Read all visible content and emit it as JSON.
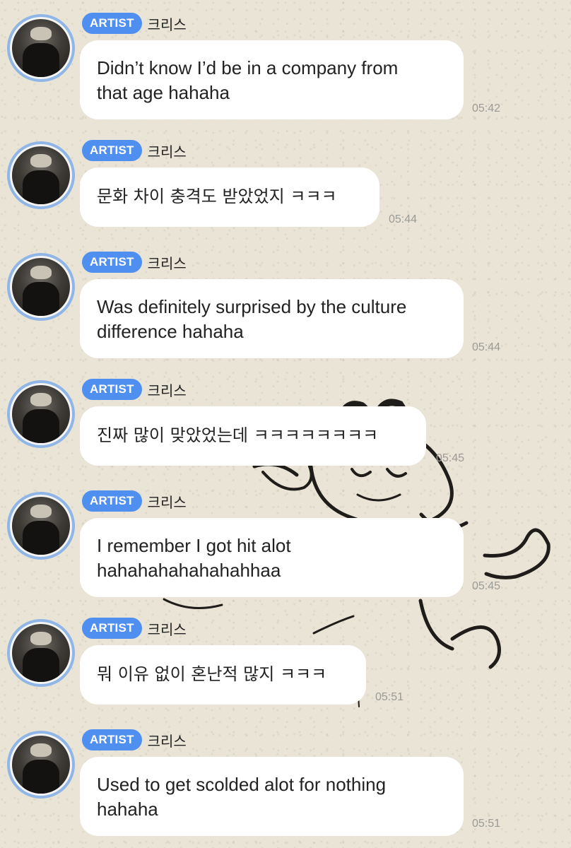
{
  "badge_label": "ARTIST",
  "sender_name": "크리스",
  "messages": [
    {
      "lines": [
        "Didn’t know I’d be in a company from",
        "that age hahaha"
      ],
      "time": "05:42"
    },
    {
      "lines": [
        "문화 차이 충격도 받았었지 ㅋㅋㅋ"
      ],
      "time": "05:44"
    },
    {
      "lines": [
        "Was definitely surprised by the culture",
        "difference hahaha"
      ],
      "time": "05:44"
    },
    {
      "lines": [
        "진짜 많이 맞았었는데 ㅋㅋㅋㅋㅋㅋㅋㅋ"
      ],
      "time": "05:45"
    },
    {
      "lines": [
        "I remember I got hit alot",
        "hahahahahahahahhaa"
      ],
      "time": "05:45"
    },
    {
      "lines": [
        "뭐 이유 없이 혼난적 많지 ㅋㅋㅋ"
      ],
      "time": "05:51"
    },
    {
      "lines": [
        "Used to get scolded alot for nothing",
        "hahaha"
      ],
      "time": "05:51"
    }
  ],
  "colors": {
    "badge": "#4f8ff0",
    "avatar_ring": "#8fb6e6",
    "background": "#e9e4d6"
  }
}
